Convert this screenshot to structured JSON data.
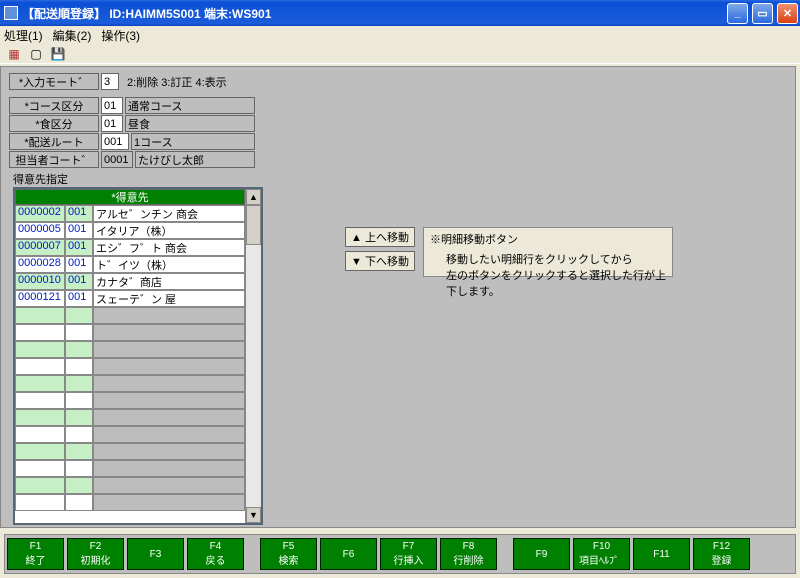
{
  "window": {
    "title": "【配送順登録】 ID:HAIMM5S001 端末:WS901"
  },
  "menu": {
    "m1": "処理(1)",
    "m2": "編集(2)",
    "m3": "操作(3)"
  },
  "form": {
    "input_mode": {
      "label": "*入力モート゛",
      "value": "3",
      "hint": "2:削除 3:訂正 4:表示"
    },
    "course": {
      "label": "*コース区分",
      "code": "01",
      "name": "通常コース"
    },
    "meal": {
      "label": "*食区分",
      "code": "01",
      "name": "昼食"
    },
    "route": {
      "label": "*配送ルート",
      "code": "001",
      "name": "1コース"
    },
    "staff": {
      "label": "担当者コート゛",
      "code": "0001",
      "name": "たけびし太郎"
    }
  },
  "section": {
    "label": "得意先指定",
    "header": "*得意先"
  },
  "rows": [
    {
      "c1": "0000002",
      "c2": "001",
      "c3": "アルセ゛ンチン 商会"
    },
    {
      "c1": "0000005",
      "c2": "001",
      "c3": "イタリア（株）"
    },
    {
      "c1": "0000007",
      "c2": "001",
      "c3": "エシ゛フ゜ト 商会"
    },
    {
      "c1": "0000028",
      "c2": "001",
      "c3": "ト゛イツ（株）"
    },
    {
      "c1": "0000010",
      "c2": "001",
      "c3": "カナタ゛商店"
    },
    {
      "c1": "0000121",
      "c2": "001",
      "c3": "スェーテ゛ン 屋"
    }
  ],
  "move": {
    "up": "▲ 上へ移動",
    "down": "▼ 下へ移動",
    "title": "※明細移動ボタン",
    "line1": "移動したい明細行をクリックしてから",
    "line2": "左のボタンをクリックすると選択した行が上下します。"
  },
  "fkeys": [
    {
      "k": "F1",
      "t": "終了"
    },
    {
      "k": "F2",
      "t": "初期化"
    },
    {
      "k": "F3",
      "t": ""
    },
    {
      "k": "F4",
      "t": "戻る"
    },
    {
      "k": "F5",
      "t": "検索"
    },
    {
      "k": "F6",
      "t": ""
    },
    {
      "k": "F7",
      "t": "行挿入"
    },
    {
      "k": "F8",
      "t": "行削除"
    },
    {
      "k": "F9",
      "t": ""
    },
    {
      "k": "F10",
      "t": "項目ﾍﾙﾌ゜"
    },
    {
      "k": "F11",
      "t": ""
    },
    {
      "k": "F12",
      "t": "登録"
    }
  ]
}
